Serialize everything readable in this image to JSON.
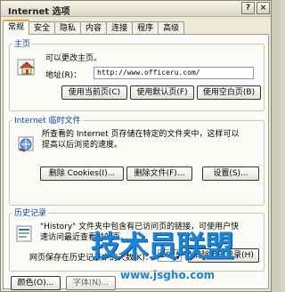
{
  "window": {
    "title": "Internet 选项",
    "help_label": "?",
    "close_label": "×"
  },
  "tabs": [
    "常规",
    "安全",
    "隐私",
    "内容",
    "连接",
    "程序",
    "高级"
  ],
  "homepage": {
    "group_title": "主页",
    "description": "可以更改主页。",
    "address_label": "地址(R)：",
    "address_value": "http://www.officeru.com/",
    "buttons": [
      "使用当前页(C)",
      "使用默认页(F)",
      "使用空白页(B)"
    ]
  },
  "temp_files": {
    "group_title": "Internet 临时文件",
    "description_line1": "所查看的 Internet 页存储在特定的文件夹中，这样可以",
    "description_line2": "提高以后浏览的速度。",
    "buttons": [
      "删除 Cookies(I)...",
      "删除文件(F)...",
      "设置(S)..."
    ]
  },
  "history": {
    "group_title": "历史记录",
    "description_line1": "\"History\" 文件夹中包含有已访问页的链接，可使用户快",
    "description_line2": "速访问最近查看过的页。",
    "days_label": "网页保存在历史记录中的天数(K)：",
    "days_value": "20",
    "clear_button": "清除历史记录(H)"
  },
  "bottom_buttons": [
    "颜色(O)...",
    "字体(N)..."
  ],
  "watermark": {
    "text": "技术员联盟",
    "url": "www.jsgho.com"
  }
}
